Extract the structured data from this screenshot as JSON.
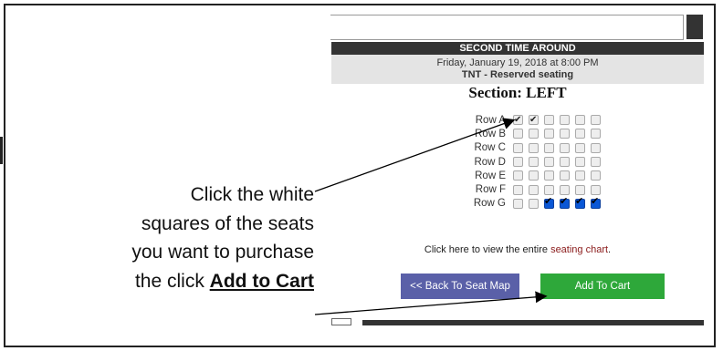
{
  "event": {
    "title": "SECOND TIME AROUND",
    "date": "Friday, January 19, 2018 at 8:00 PM",
    "venue": "TNT - Reserved seating",
    "section": "Section: LEFT"
  },
  "seating": {
    "rows": [
      {
        "label": "Row A",
        "seats": [
          "checked",
          "checked",
          "empty",
          "empty",
          "empty",
          "empty"
        ]
      },
      {
        "label": "Row B",
        "seats": [
          "empty",
          "empty",
          "empty",
          "empty",
          "empty",
          "empty"
        ]
      },
      {
        "label": "Row C",
        "seats": [
          "empty",
          "empty",
          "empty",
          "empty",
          "empty",
          "empty"
        ]
      },
      {
        "label": "Row D",
        "seats": [
          "empty",
          "empty",
          "empty",
          "empty",
          "empty",
          "empty"
        ]
      },
      {
        "label": "Row E",
        "seats": [
          "empty",
          "empty",
          "empty",
          "empty",
          "empty",
          "empty"
        ]
      },
      {
        "label": "Row F",
        "seats": [
          "empty",
          "empty",
          "empty",
          "empty",
          "empty",
          "empty"
        ]
      },
      {
        "label": "Row G",
        "seats": [
          "empty",
          "empty",
          "taken",
          "taken",
          "taken",
          "taken"
        ]
      }
    ]
  },
  "chart_link": {
    "prefix": "Click here to view the entire ",
    "link": "seating chart",
    "suffix": "."
  },
  "buttons": {
    "back": "<< Back To Seat Map",
    "add": "Add To Cart"
  },
  "callout": {
    "line1": "Click the white",
    "line2": "squares of the seats",
    "line3": "you want to purchase",
    "line4_prefix": "the click ",
    "line4_bold": "Add to Cart"
  },
  "colors": {
    "back_button": "#5a60a8",
    "cart_button": "#2ea83a",
    "taken_seat": "#0a57d6",
    "link": "#8a1a1a"
  }
}
